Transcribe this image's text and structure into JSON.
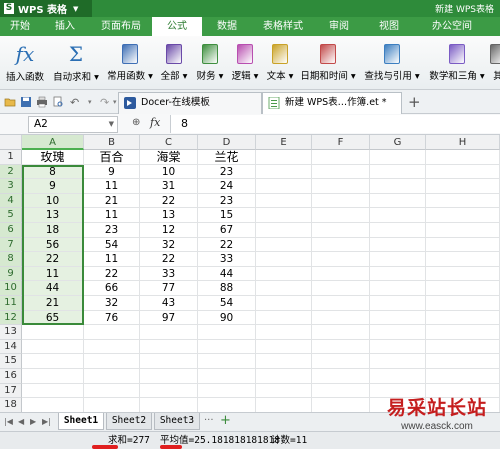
{
  "app": {
    "brand": "WPS 表格",
    "right_text": "新建 WPS表格"
  },
  "menubar": [
    {
      "label": "开始",
      "w": 40
    },
    {
      "label": "插入",
      "w": 50
    },
    {
      "label": "页面布局",
      "w": 62
    },
    {
      "label": "公式",
      "w": 50,
      "active": true
    },
    {
      "label": "数据",
      "w": 50
    },
    {
      "label": "表格样式",
      "w": 62
    },
    {
      "label": "审阅",
      "w": 50
    },
    {
      "label": "视图",
      "w": 50
    },
    {
      "label": "办公空间",
      "w": 76
    }
  ],
  "ribbon": [
    {
      "label": "插入函数",
      "icon": "fx-icon",
      "color": "#2a6eb3"
    },
    {
      "label": "自动求和 ▾",
      "icon": "sum-icon",
      "color": "#2a6eb3"
    },
    {
      "label": "常用函数 ▾",
      "icon": "common-functions-icon",
      "color": "#3f6fb5"
    },
    {
      "label": "全部 ▾",
      "icon": "all-functions-icon",
      "color": "#6a4aa8"
    },
    {
      "label": "财务 ▾",
      "icon": "finance-icon",
      "color": "#3f8f3f"
    },
    {
      "label": "逻辑 ▾",
      "icon": "logic-icon",
      "color": "#b84fb0"
    },
    {
      "label": "文本 ▾",
      "icon": "text-icon",
      "color": "#c9a227"
    },
    {
      "label": "日期和时间 ▾",
      "icon": "date-time-icon",
      "color": "#c24a4a"
    },
    {
      "label": "查找与引用 ▾",
      "icon": "lookup-icon",
      "color": "#3d7fc0"
    },
    {
      "label": "数学和三角 ▾",
      "icon": "math-trig-icon",
      "color": "#7b5cc4"
    },
    {
      "label": "其",
      "icon": "more-icon",
      "color": "#666666"
    }
  ],
  "tabs": [
    {
      "label": "Docer-在线模板",
      "active": false
    },
    {
      "label": "新建 WPS表…作簿.et *",
      "active": true
    }
  ],
  "formula_bar": {
    "cell_ref": "A2",
    "fx": "fx",
    "value": "8"
  },
  "columns": [
    "A",
    "B",
    "C",
    "D",
    "E",
    "F",
    "G",
    "H"
  ],
  "headers": [
    "玫瑰",
    "百合",
    "海棠",
    "兰花"
  ],
  "rows": [
    [
      "8",
      "9",
      "10",
      "23"
    ],
    [
      "9",
      "11",
      "31",
      "24"
    ],
    [
      "10",
      "21",
      "22",
      "23"
    ],
    [
      "13",
      "11",
      "13",
      "15"
    ],
    [
      "18",
      "23",
      "12",
      "67"
    ],
    [
      "56",
      "54",
      "32",
      "22"
    ],
    [
      "22",
      "11",
      "22",
      "33"
    ],
    [
      "11",
      "22",
      "33",
      "44"
    ],
    [
      "44",
      "66",
      "77",
      "88"
    ],
    [
      "21",
      "32",
      "43",
      "54"
    ],
    [
      "65",
      "76",
      "97",
      "90"
    ]
  ],
  "row_count": 18,
  "sheets": [
    "Sheet1",
    "Sheet2",
    "Sheet3"
  ],
  "status": {
    "sum": "求和=277",
    "avg": "平均值=25.181818181818",
    "count": "计数=11"
  },
  "watermark": {
    "title": "易采站长站",
    "url": "www.easck.com"
  }
}
